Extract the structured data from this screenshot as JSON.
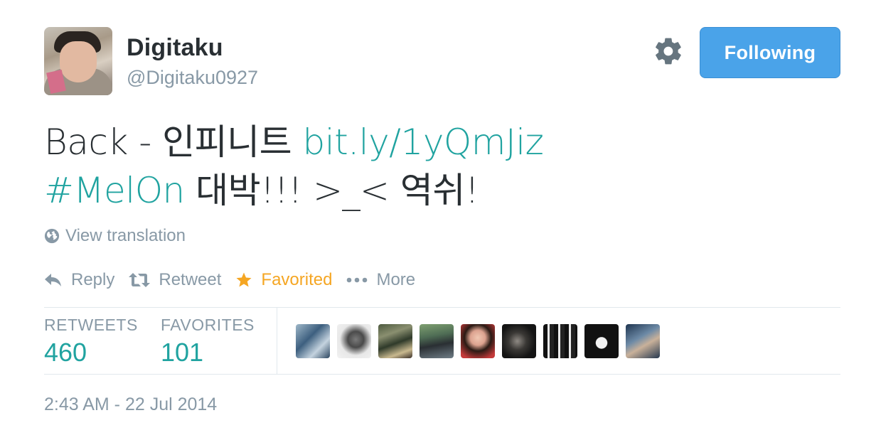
{
  "user": {
    "name": "Digitaku",
    "handle": "@Digitaku0927"
  },
  "follow_button": {
    "label": "Following",
    "color": "#4aa3e9"
  },
  "tweet": {
    "line1_text": "Back - 인피니트 ",
    "line1_link": "bit.ly/1yQmJiz",
    "line2_hashtag": " #MelOn",
    "line2_text": " 대박!!! >_< 역쉬!",
    "link_color": "#20a3a0"
  },
  "translation": {
    "label": "View translation",
    "icon": "globe-icon"
  },
  "actions": [
    {
      "label": "Reply",
      "icon": "reply-icon"
    },
    {
      "label": "Retweet",
      "icon": "retweet-icon"
    },
    {
      "label": "Favorited",
      "icon": "star-icon",
      "color": "#f5a623"
    },
    {
      "label": "More",
      "icon": "more-dots-icon"
    }
  ],
  "stats": {
    "retweets_label": "RETWEETS",
    "retweets_value": "460",
    "favorites_label": "FAVORITES",
    "favorites_value": "101"
  },
  "favoriters": [
    {
      "icon": "user-avatar-icon"
    },
    {
      "icon": "user-avatar-icon"
    },
    {
      "icon": "user-avatar-icon"
    },
    {
      "icon": "user-avatar-icon"
    },
    {
      "icon": "user-avatar-icon"
    },
    {
      "icon": "user-avatar-icon"
    },
    {
      "icon": "user-avatar-icon"
    },
    {
      "icon": "user-avatar-icon"
    },
    {
      "icon": "user-avatar-icon"
    }
  ],
  "timestamp": "2:43 AM - 22 Jul 2014"
}
